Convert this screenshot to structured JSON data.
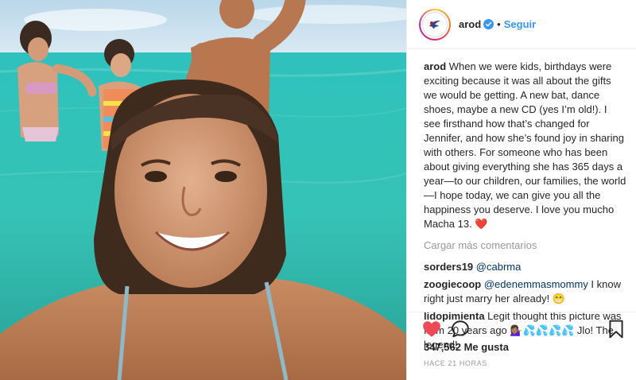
{
  "post": {
    "username": "arod",
    "follow_label": "Seguir",
    "dot": "•",
    "caption_user": "arod",
    "caption_text": " When we were kids, birthdays were exciting because it was all about the gifts we would be getting. A new bat, dance shoes, maybe a new CD (yes I’m old!). I see firsthand how that’s changed for Jennifer, and how she’s found joy in sharing with others. For someone who has been about giving everything she has 365 days a year—to our children, our families, the world—I hope today, we can give you all the happiness you deserve. I love you mucho Macha 13. ",
    "caption_emoji": "❤️",
    "load_more": "Cargar más comentarios",
    "comments": [
      {
        "user": "sorders19",
        "mention": "@cabrma",
        "text": ""
      },
      {
        "user": "zoogiecoop",
        "mention": "@edenemmasmommy",
        "text": " I know right just marry her already! 😁"
      },
      {
        "user": "lidopimienta",
        "mention": "",
        "text": " Legit thought this picture was from 20 years ago 💁🏽‍♀️💦💦💦💦 Jlo! The legend!"
      }
    ],
    "likes": "347,562 Me gusta",
    "timestamp": "HACE 21 HORAS"
  },
  "colors": {
    "link_blue": "#3897f0",
    "like_red": "#ed4956",
    "muted": "#999999"
  },
  "icons": [
    "verified-badge-icon",
    "heart-icon",
    "comment-icon",
    "bookmark-icon",
    "avatar-logo-icon"
  ]
}
